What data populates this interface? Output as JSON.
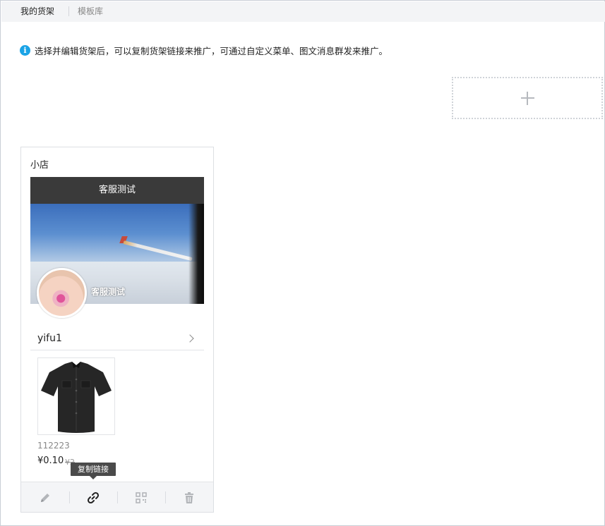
{
  "tabs": [
    {
      "label": "我的货架",
      "active": true
    },
    {
      "label": "模板库",
      "active": false
    }
  ],
  "notice": {
    "icon": "info-icon",
    "text": "选择并编辑货架后，可以复制货架链接来推广，可通过自定义菜单、图文消息群发来推广。"
  },
  "add_shelf": {
    "icon": "plus-icon"
  },
  "shelf_card": {
    "title": "小店",
    "shop_header": "客服测试",
    "avatar_name": "客服测试",
    "category_label": "yifu1",
    "product": {
      "name": "112223",
      "price": "¥0.10",
      "old_price": "¥2"
    },
    "tooltip": "复制链接",
    "actions": [
      {
        "name": "edit",
        "icon": "pencil-icon"
      },
      {
        "name": "copy-link",
        "icon": "link-icon"
      },
      {
        "name": "qr-code",
        "icon": "qrcode-icon"
      },
      {
        "name": "delete",
        "icon": "trash-icon"
      }
    ]
  },
  "colors": {
    "info_blue": "#1aa3e6",
    "header_dark": "#3a3a3a",
    "tab_bg": "#f3f4f6",
    "footer_bg": "#f4f5f7"
  }
}
